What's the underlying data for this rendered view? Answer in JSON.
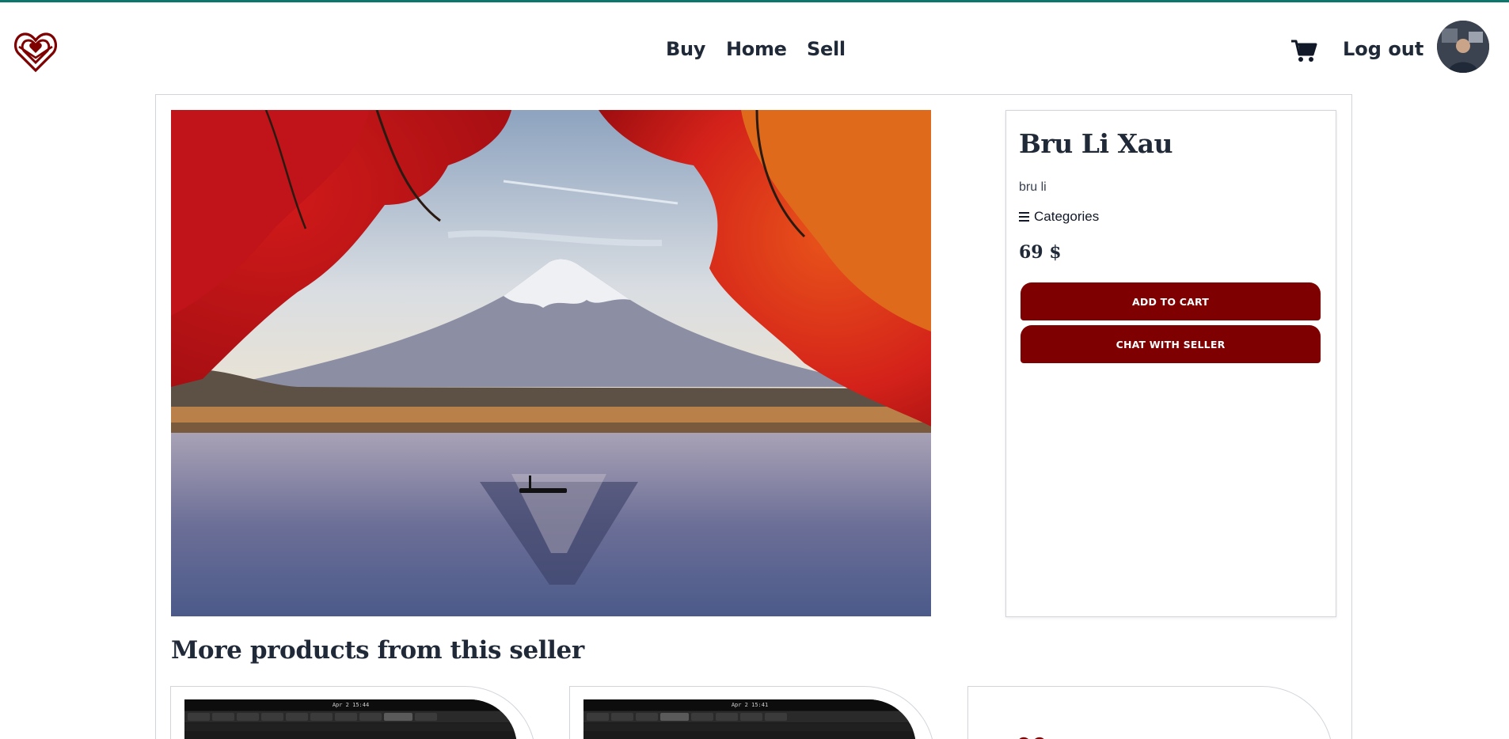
{
  "header": {
    "nav": [
      "Buy",
      "Home",
      "Sell"
    ],
    "logout_label": "Log out",
    "icons": {
      "logo": "heart-shield-logo",
      "cart": "cart-icon",
      "avatar": "user-avatar"
    },
    "accent_color": "#0f766e"
  },
  "product": {
    "title": "Bru Li Xau",
    "description": "bru li",
    "categories_label": "Categories",
    "price": "69 $",
    "add_to_cart_label": "ADD TO CART",
    "chat_label": "CHAT WITH SELLER",
    "button_color": "#7f0000"
  },
  "more_section": {
    "title": "More products from this seller",
    "cards": [
      {
        "thumb_caption": "Apr 2  15:44"
      },
      {
        "thumb_caption": "Apr 2  15:41"
      },
      {
        "thumb_caption": ""
      }
    ]
  }
}
